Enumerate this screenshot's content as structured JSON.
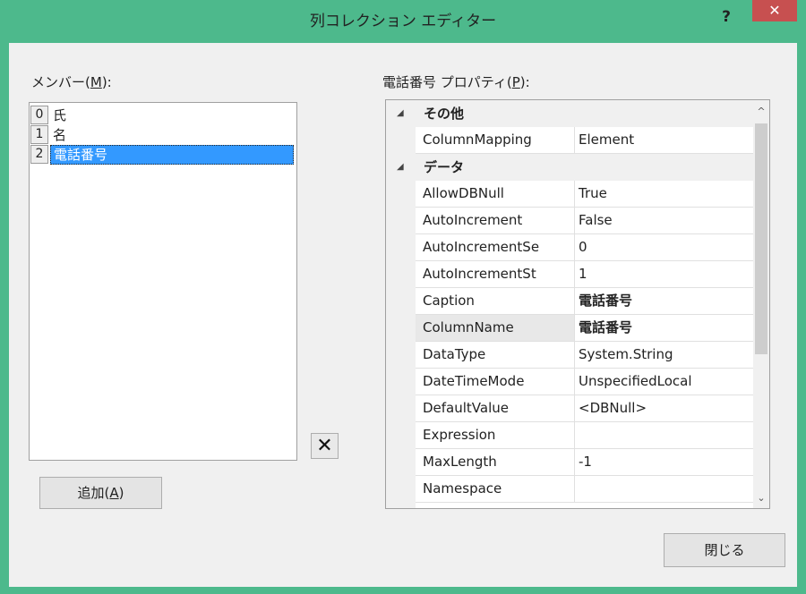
{
  "window": {
    "title": "列コレクション エディター",
    "help": "?",
    "close": "✕"
  },
  "members": {
    "label_prefix": "メンバー(",
    "label_key": "M",
    "label_suffix": "):",
    "items": [
      {
        "index": "0",
        "name": "氏"
      },
      {
        "index": "1",
        "name": "名"
      },
      {
        "index": "2",
        "name": "電話番号"
      }
    ],
    "selected_index": 2
  },
  "buttons": {
    "add_prefix": "追加(",
    "add_key": "A",
    "add_suffix": ")",
    "remove": "✕",
    "close": "閉じる"
  },
  "properties": {
    "label_prefix": "電話番号 プロパティ(",
    "label_key": "P",
    "label_suffix": "):",
    "categories": [
      {
        "name": "その他",
        "rows": [
          {
            "name": "ColumnMapping",
            "value": "Element"
          }
        ]
      },
      {
        "name": "データ",
        "rows": [
          {
            "name": "AllowDBNull",
            "value": "True"
          },
          {
            "name": "AutoIncrement",
            "value": "False"
          },
          {
            "name": "AutoIncrementSe",
            "value": "0"
          },
          {
            "name": "AutoIncrementSt",
            "value": "1"
          },
          {
            "name": "Caption",
            "value": "電話番号"
          },
          {
            "name": "ColumnName",
            "value": "電話番号"
          },
          {
            "name": "DataType",
            "value": "System.String"
          },
          {
            "name": "DateTimeMode",
            "value": "UnspecifiedLocal"
          },
          {
            "name": "DefaultValue",
            "value": "<DBNull>"
          },
          {
            "name": "Expression",
            "value": ""
          },
          {
            "name": "MaxLength",
            "value": "-1"
          },
          {
            "name": "Namespace",
            "value": ""
          }
        ]
      }
    ],
    "collapse_glyph": "◢",
    "scroll_up": "^",
    "scroll_down": "⌄"
  }
}
